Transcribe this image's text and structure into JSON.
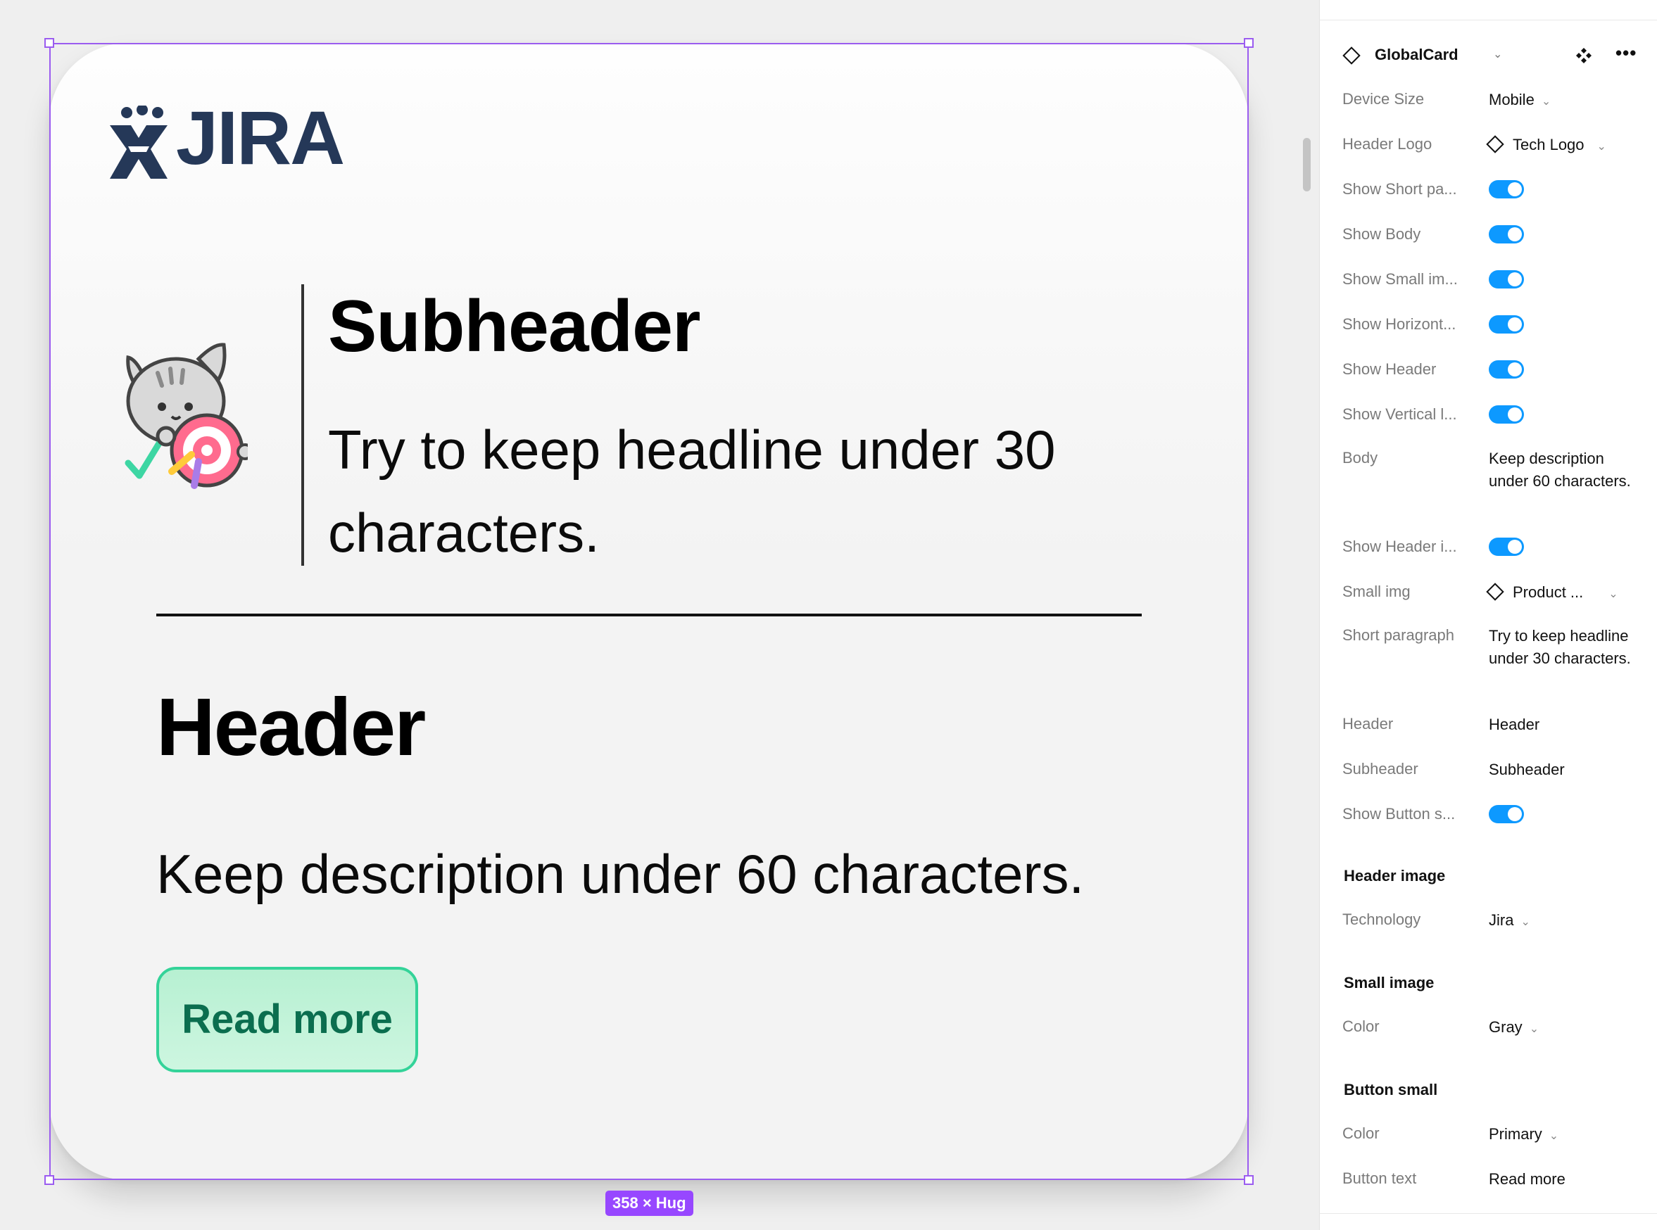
{
  "card": {
    "logo_text": "JIRA",
    "subheader": "Subheader",
    "short_paragraph": "Try to keep headline under 30 characters.",
    "header": "Header",
    "body": "Keep description under 60 characters.",
    "button_text": "Read more",
    "size_badge": "358 × Hug"
  },
  "panel": {
    "component_name": "GlobalCard",
    "properties": [
      {
        "label": "Device Size",
        "value": "Mobile",
        "type": "dropdown"
      },
      {
        "label": "Header Logo",
        "value": "Tech Logo",
        "type": "instance"
      },
      {
        "label": "Show Short pa...",
        "value": "on",
        "type": "toggle"
      },
      {
        "label": "Show Body",
        "value": "on",
        "type": "toggle"
      },
      {
        "label": "Show Small im...",
        "value": "on",
        "type": "toggle"
      },
      {
        "label": "Show Horizont...",
        "value": "on",
        "type": "toggle"
      },
      {
        "label": "Show Header",
        "value": "on",
        "type": "toggle"
      },
      {
        "label": "Show Vertical l...",
        "value": "on",
        "type": "toggle"
      },
      {
        "label": "Body",
        "value": "Keep description under 60 characters.",
        "type": "text"
      },
      {
        "label": "Show Header i...",
        "value": "on",
        "type": "toggle"
      },
      {
        "label": "Small img",
        "value": "Product ...",
        "type": "instance"
      },
      {
        "label": "Short paragraph",
        "value": "Try to keep headline under 30 characters.",
        "type": "text"
      },
      {
        "label": "Header",
        "value": "Header",
        "type": "text"
      },
      {
        "label": "Subheader",
        "value": "Subheader",
        "type": "text"
      },
      {
        "label": "Show Button s...",
        "value": "on",
        "type": "toggle"
      }
    ],
    "sections": [
      {
        "title": "Header image",
        "properties": [
          {
            "label": "Technology",
            "value": "Jira",
            "type": "dropdown"
          }
        ]
      },
      {
        "title": "Small image",
        "properties": [
          {
            "label": "Color",
            "value": "Gray",
            "type": "dropdown"
          }
        ]
      },
      {
        "title": "Button small",
        "properties": [
          {
            "label": "Color",
            "value": "Primary",
            "type": "dropdown"
          },
          {
            "label": "Button text",
            "value": "Read more",
            "type": "text"
          }
        ]
      }
    ]
  },
  "colors": {
    "selection": "#9b5cf0",
    "toggle_on": "#0d99ff",
    "jira_blue": "#253858",
    "button_border": "#34d399",
    "button_text": "#0b6e4f"
  }
}
